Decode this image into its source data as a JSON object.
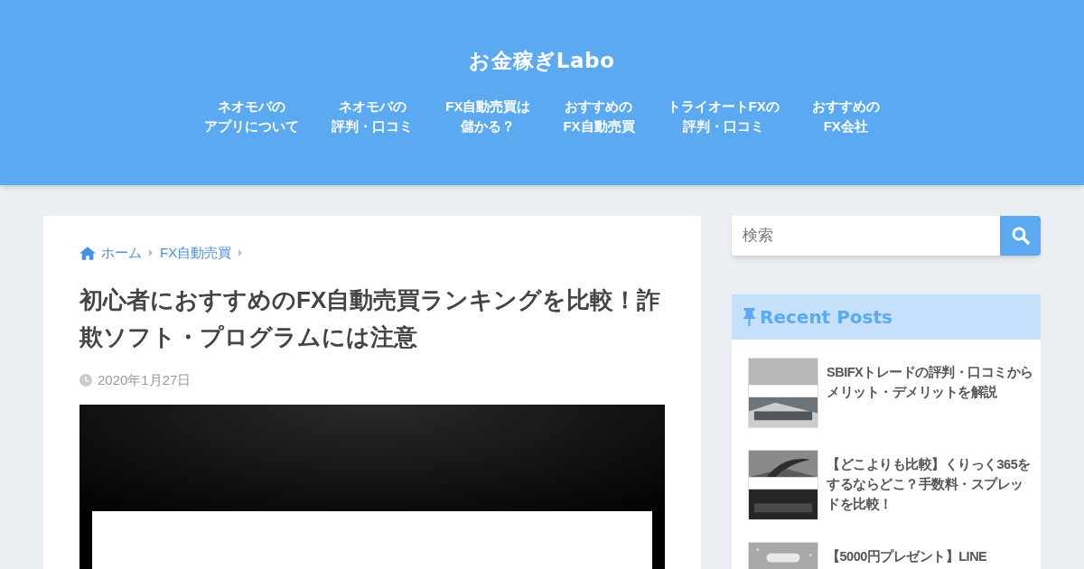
{
  "site_title": "お金稼ぎLabo",
  "nav": [
    {
      "lines": [
        "ネオモバの",
        "アプリについて"
      ]
    },
    {
      "lines": [
        "ネオモバの",
        "評判・口コミ"
      ]
    },
    {
      "lines": [
        "FX自動売買は",
        "儲かる？"
      ]
    },
    {
      "lines": [
        "おすすめの",
        "FX自動売買"
      ]
    },
    {
      "lines": [
        "トライオートFXの",
        "評判・口コミ"
      ]
    },
    {
      "lines": [
        "おすすめの",
        "FX会社"
      ]
    }
  ],
  "breadcrumb": [
    "ホーム",
    "FX自動売買"
  ],
  "article": {
    "title": "初心者におすすめのFX自動売買ランキングを比較！詐欺ソフト・プログラムには注意",
    "date": "2020年1月27日"
  },
  "search": {
    "placeholder": "検索"
  },
  "recent_posts": {
    "heading": "Recent Posts",
    "items": [
      {
        "title": "SBIFXトレードの評判・口コミからメリット・デメリットを解説",
        "thumb": {
          "kind": "sea"
        }
      },
      {
        "title": "【どこよりも比較】くりっく365をするならどこ？手数料・スプレッドを比較！",
        "thumb": {
          "kind": "palm"
        }
      },
      {
        "title": "【5000円プレゼント】LINE",
        "thumb": {
          "kind": "plain"
        }
      }
    ]
  }
}
